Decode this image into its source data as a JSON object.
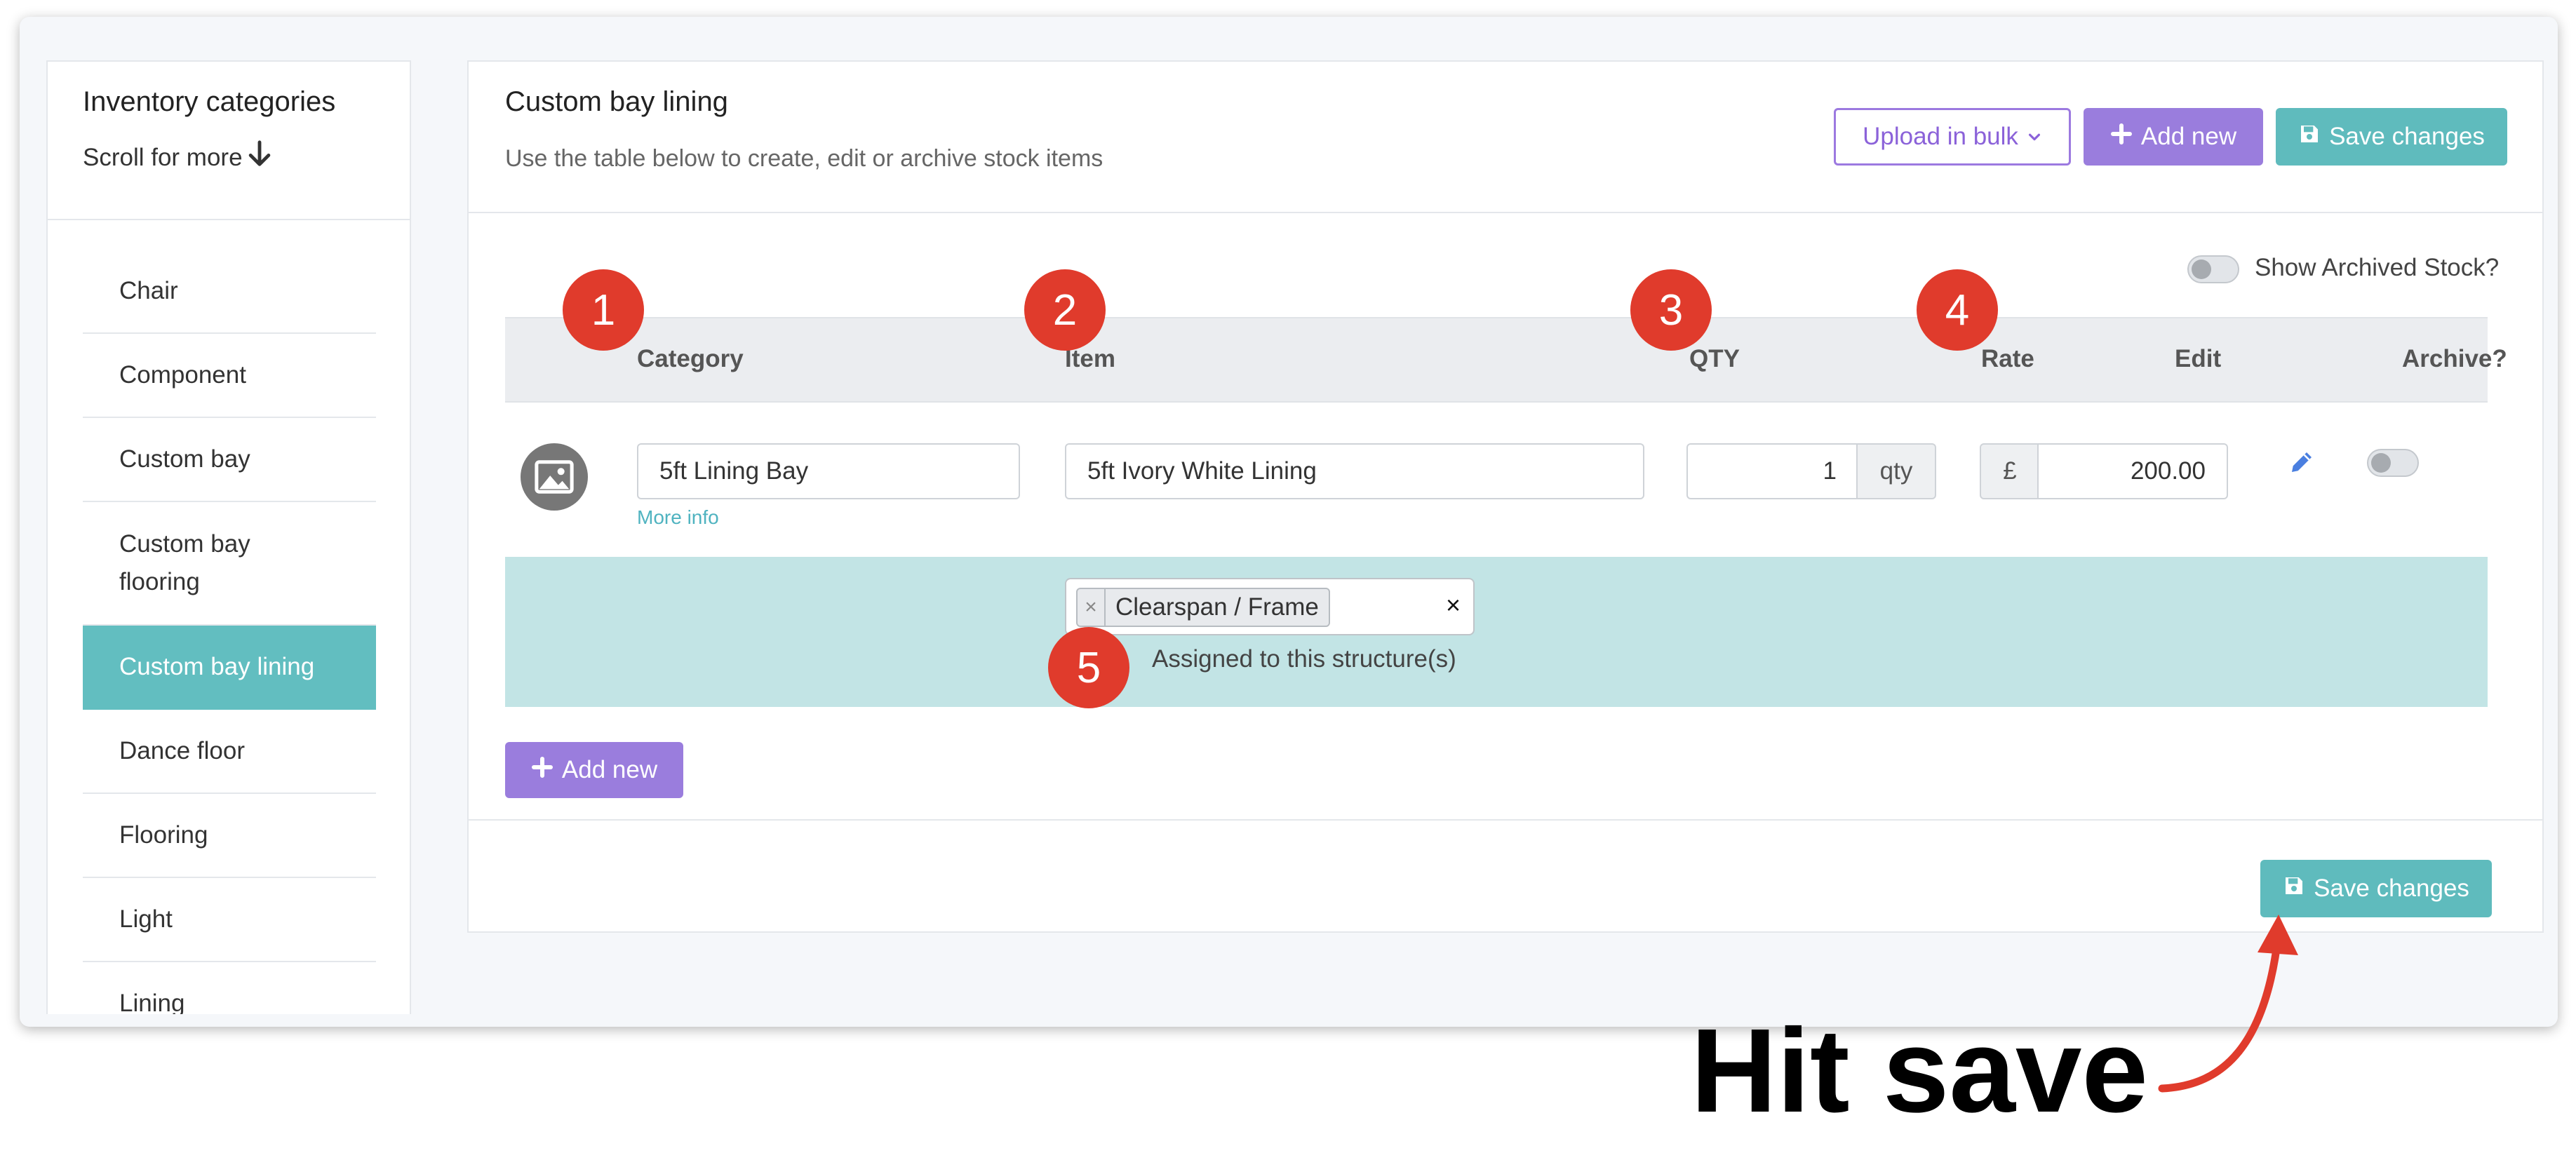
{
  "sidebar": {
    "title": "Inventory categories",
    "scroll_hint": "Scroll for more",
    "items": [
      {
        "label": "Chair"
      },
      {
        "label": "Component"
      },
      {
        "label": "Custom bay"
      },
      {
        "label": "Custom bay flooring"
      },
      {
        "label": "Custom bay lining",
        "active": true
      },
      {
        "label": "Dance floor"
      },
      {
        "label": "Flooring"
      },
      {
        "label": "Light"
      },
      {
        "label": "Lining"
      }
    ]
  },
  "main": {
    "title": "Custom bay lining",
    "subtitle": "Use the table below to create, edit or archive stock items",
    "buttons": {
      "upload_bulk": "Upload in bulk",
      "add_new": "Add new",
      "save_changes": "Save changes"
    },
    "show_archived_label": "Show Archived Stock?",
    "columns": {
      "category": "Category",
      "item": "Item",
      "qty": "QTY",
      "rate": "Rate",
      "edit": "Edit",
      "archive": "Archive?"
    },
    "row": {
      "category": "5ft Lining Bay",
      "more_info": "More info",
      "item": "5ft Ivory White Lining",
      "qty": "1",
      "qty_unit": "qty",
      "currency": "£",
      "rate": "200.00"
    },
    "assignment": {
      "tag": "Clearspan / Frame",
      "tag_remove": "×",
      "clear": "×",
      "label": "Assigned to this structure(s)"
    },
    "add_new_row": "Add new",
    "footer_save": "Save changes"
  },
  "badges": [
    "1",
    "2",
    "3",
    "4",
    "5"
  ],
  "annotation": "Hit save",
  "colors": {
    "teal": "#5fbbbd",
    "purple": "#9a7ddd",
    "badge_red": "#e03b2c",
    "assign_bg": "#c2e4e5"
  }
}
